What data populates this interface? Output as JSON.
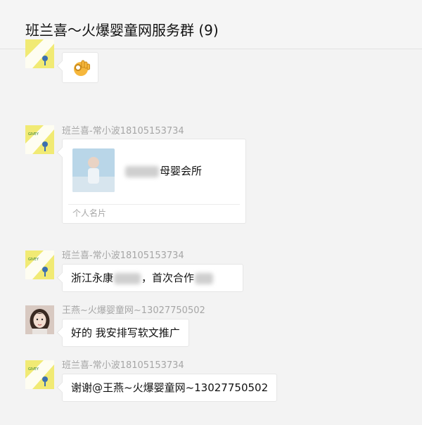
{
  "window": {
    "title": "班兰喜～火爆婴童网服务群 (9)"
  },
  "messages": [
    {
      "sender": "",
      "type": "emoji",
      "emoji": "ok-hand-icon"
    },
    {
      "sender": "班兰喜-常小波18105153734",
      "type": "card",
      "card": {
        "name_visible": "母婴会所",
        "footer": "个人名片"
      }
    },
    {
      "sender": "班兰喜-常小波18105153734",
      "type": "text",
      "text_part1": "浙江永康",
      "text_part2": "，首次合作"
    },
    {
      "sender": "王燕~火爆婴童网~13027750502",
      "type": "text",
      "text": "好的 我安排写软文推广"
    },
    {
      "sender": "班兰喜-常小波18105153734",
      "type": "text",
      "text": "谢谢@王燕~火爆婴童网~13027750502"
    }
  ],
  "colors": {
    "header_bg": "#f5f5f5",
    "chat_bg": "#f3f3f3",
    "bubble_bg": "#ffffff",
    "logo_yellow": "#f1ea74",
    "sender_gray": "#a6a6a6"
  }
}
